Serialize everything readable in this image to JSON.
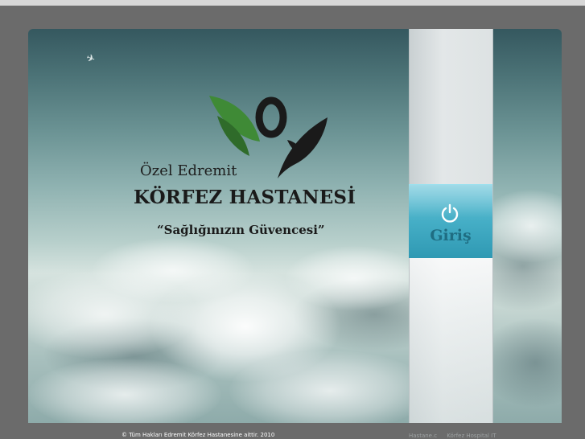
{
  "brand": {
    "prefix": "Özel Edremit",
    "name": "KÖRFEZ HASTANESİ",
    "slogan": "“Sağlığınızın Güvencesi”"
  },
  "login": {
    "label": "Giriş"
  },
  "footer": {
    "copyright": "© Tüm Hakları Edremit Körfez Hastanesine aittir. 2010",
    "links": [
      "Hastane.c",
      "Körfez Hospital IT"
    ]
  },
  "colors": {
    "login_tile": "#45aec6",
    "leaf_green": "#3f8a36",
    "logo_dark": "#1a1a1a"
  },
  "icons": {
    "login": "power-icon",
    "logo": "hospital-logo"
  }
}
